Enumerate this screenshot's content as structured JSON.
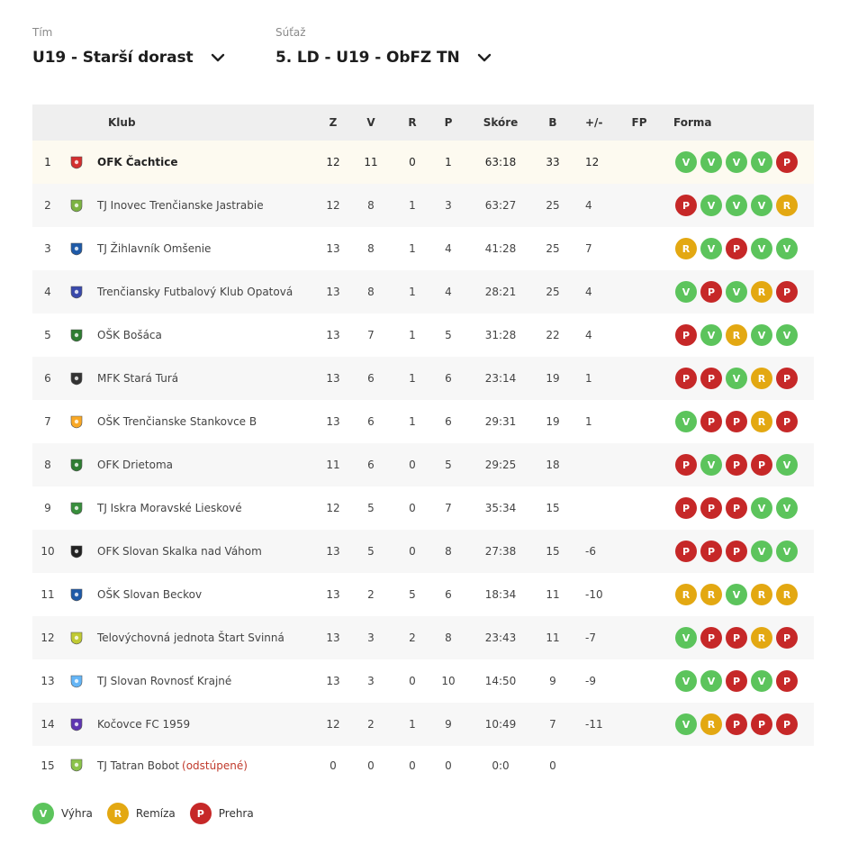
{
  "filters": {
    "team": {
      "label": "Tím",
      "value": "U19 - Starší dorast"
    },
    "competition": {
      "label": "Súťaž",
      "value": "5. LD - U19 - ObFZ TN"
    }
  },
  "table": {
    "headers": {
      "club": "Klub",
      "z": "Z",
      "v": "V",
      "r": "R",
      "p": "P",
      "score": "Skóre",
      "b": "B",
      "pm": "+/-",
      "fp": "FP",
      "form": "Forma"
    },
    "rows": [
      {
        "rank": "1",
        "club": "OFK Čachtice",
        "z": "12",
        "v": "11",
        "r": "0",
        "p": "1",
        "score": "63:18",
        "b": "33",
        "pm": "12",
        "fp": "",
        "form": [
          "V",
          "V",
          "V",
          "V",
          "P"
        ],
        "crest": "#d32f2f"
      },
      {
        "rank": "2",
        "club": "TJ Inovec Trenčianske Jastrabie",
        "z": "12",
        "v": "8",
        "r": "1",
        "p": "3",
        "score": "63:27",
        "b": "25",
        "pm": "4",
        "fp": "",
        "form": [
          "P",
          "V",
          "V",
          "V",
          "R"
        ],
        "crest": "#7cb342"
      },
      {
        "rank": "3",
        "club": "TJ Žihlavník Omšenie",
        "z": "13",
        "v": "8",
        "r": "1",
        "p": "4",
        "score": "41:28",
        "b": "25",
        "pm": "7",
        "fp": "",
        "form": [
          "R",
          "V",
          "P",
          "V",
          "V"
        ],
        "crest": "#1e5aa8"
      },
      {
        "rank": "4",
        "club": "Trenčiansky Futbalový Klub Opatová",
        "z": "13",
        "v": "8",
        "r": "1",
        "p": "4",
        "score": "28:21",
        "b": "25",
        "pm": "4",
        "fp": "",
        "form": [
          "V",
          "P",
          "V",
          "R",
          "P"
        ],
        "crest": "#3949ab"
      },
      {
        "rank": "5",
        "club": "OŠK Bošáca",
        "z": "13",
        "v": "7",
        "r": "1",
        "p": "5",
        "score": "31:28",
        "b": "22",
        "pm": "4",
        "fp": "",
        "form": [
          "P",
          "V",
          "R",
          "V",
          "V"
        ],
        "crest": "#2e7d32"
      },
      {
        "rank": "6",
        "club": "MFK Stará Turá",
        "z": "13",
        "v": "6",
        "r": "1",
        "p": "6",
        "score": "23:14",
        "b": "19",
        "pm": "1",
        "fp": "",
        "form": [
          "P",
          "P",
          "V",
          "R",
          "P"
        ],
        "crest": "#333333"
      },
      {
        "rank": "7",
        "club": "OŠK Trenčianske Stankovce B",
        "z": "13",
        "v": "6",
        "r": "1",
        "p": "6",
        "score": "29:31",
        "b": "19",
        "pm": "1",
        "fp": "",
        "form": [
          "V",
          "P",
          "P",
          "R",
          "P"
        ],
        "crest": "#f9a825"
      },
      {
        "rank": "8",
        "club": "OFK Drietoma",
        "z": "11",
        "v": "6",
        "r": "0",
        "p": "5",
        "score": "29:25",
        "b": "18",
        "pm": "",
        "fp": "",
        "form": [
          "P",
          "V",
          "P",
          "P",
          "V"
        ],
        "crest": "#2e7d32"
      },
      {
        "rank": "9",
        "club": "TJ Iskra Moravské Lieskové",
        "z": "12",
        "v": "5",
        "r": "0",
        "p": "7",
        "score": "35:34",
        "b": "15",
        "pm": "",
        "fp": "",
        "form": [
          "P",
          "P",
          "P",
          "V",
          "V"
        ],
        "crest": "#388e3c"
      },
      {
        "rank": "10",
        "club": "OFK Slovan Skalka nad Váhom",
        "z": "13",
        "v": "5",
        "r": "0",
        "p": "8",
        "score": "27:38",
        "b": "15",
        "pm": "-6",
        "fp": "",
        "form": [
          "P",
          "P",
          "P",
          "V",
          "V"
        ],
        "crest": "#222222"
      },
      {
        "rank": "11",
        "club": "OŠK Slovan Beckov",
        "z": "13",
        "v": "2",
        "r": "5",
        "p": "6",
        "score": "18:34",
        "b": "11",
        "pm": "-10",
        "fp": "",
        "form": [
          "R",
          "R",
          "V",
          "R",
          "R"
        ],
        "crest": "#1e5aa8"
      },
      {
        "rank": "12",
        "club": "Telovýchovná jednota Štart Svinná",
        "z": "13",
        "v": "3",
        "r": "2",
        "p": "8",
        "score": "23:43",
        "b": "11",
        "pm": "-7",
        "fp": "",
        "form": [
          "V",
          "P",
          "P",
          "R",
          "P"
        ],
        "crest": "#c0ca33"
      },
      {
        "rank": "13",
        "club": "TJ Slovan Rovnosť Krajné",
        "z": "13",
        "v": "3",
        "r": "0",
        "p": "10",
        "score": "14:50",
        "b": "9",
        "pm": "-9",
        "fp": "",
        "form": [
          "V",
          "V",
          "P",
          "V",
          "P"
        ],
        "crest": "#64b5f6"
      },
      {
        "rank": "14",
        "club": "Kočovce FC 1959",
        "z": "12",
        "v": "2",
        "r": "1",
        "p": "9",
        "score": "10:49",
        "b": "7",
        "pm": "-11",
        "fp": "",
        "form": [
          "V",
          "R",
          "P",
          "P",
          "P"
        ],
        "crest": "#5e35b1"
      },
      {
        "rank": "15",
        "club": "TJ Tatran Bobot",
        "retired": "(odstúpené)",
        "z": "0",
        "v": "0",
        "r": "0",
        "p": "0",
        "score": "0:0",
        "b": "0",
        "pm": "",
        "fp": "",
        "form": [],
        "crest": "#8bc34a"
      }
    ]
  },
  "legend": [
    {
      "code": "V",
      "label": "Výhra"
    },
    {
      "code": "R",
      "label": "Remíza"
    },
    {
      "code": "P",
      "label": "Prehra"
    }
  ]
}
